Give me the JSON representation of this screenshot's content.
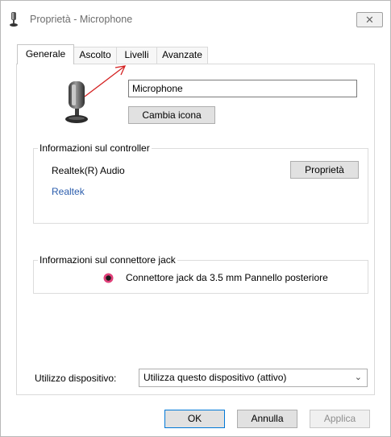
{
  "window": {
    "title": "Proprietà - Microphone",
    "close_glyph": "✕"
  },
  "tabs": [
    {
      "label": "Generale",
      "active": true
    },
    {
      "label": "Ascolto",
      "active": false
    },
    {
      "label": "Livelli",
      "active": false
    },
    {
      "label": "Avanzate",
      "active": false
    }
  ],
  "general": {
    "device_name_value": "Microphone",
    "change_icon_label": "Cambia icona",
    "controller": {
      "legend": "Informazioni sul controller",
      "name": "Realtek(R) Audio",
      "link": "Realtek",
      "properties_label": "Proprietà"
    },
    "jack": {
      "legend": "Informazioni sul connettore jack",
      "description": "Connettore jack da 3.5 mm Pannello posteriore",
      "color": "#e0417a"
    },
    "device_usage": {
      "label": "Utilizzo dispositivo:",
      "selected": "Utilizza questo dispositivo (attivo)"
    }
  },
  "footer": {
    "ok_label": "OK",
    "cancel_label": "Annulla",
    "apply_label": "Applica"
  },
  "annotation": {
    "arrow_color": "#d42020"
  }
}
